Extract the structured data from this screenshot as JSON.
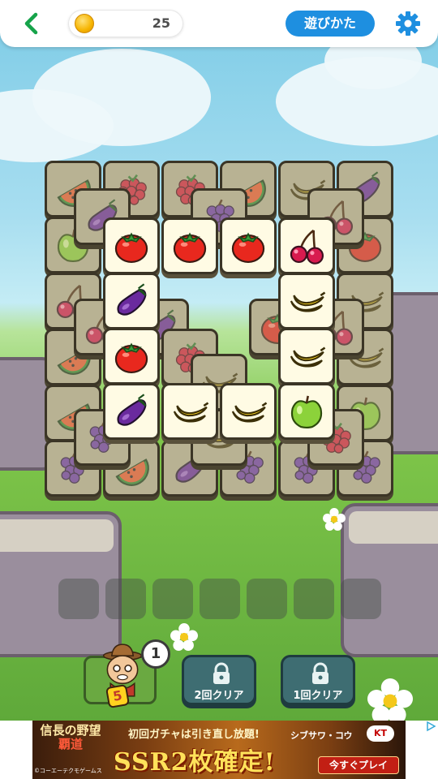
{
  "topbar": {
    "coin_count": "25",
    "howto_label": "遊びかた"
  },
  "board": {
    "tiles_bottom": [
      [
        "watermelon",
        "raspberry",
        "raspberry",
        "watermelon",
        "banana",
        "eggplant"
      ],
      [
        "apple",
        "",
        "",
        "",
        "",
        "tomato"
      ],
      [
        "cherry",
        "",
        "",
        "",
        "",
        "banana"
      ],
      [
        "watermelon",
        "",
        "",
        "",
        "",
        "banana"
      ],
      [
        "watermelon",
        "",
        "",
        "",
        "",
        "apple"
      ],
      [
        "grape",
        "watermelon",
        "eggplant",
        "grape",
        "grape",
        "grape"
      ]
    ],
    "tiles_middle": [
      "eggplant",
      "grape",
      "cherry",
      "cherry",
      "eggplant",
      "tomato",
      "cherry",
      "raspberry",
      "banana",
      "grape",
      "raspberry",
      "banana"
    ],
    "tiles_top": [
      [
        "tomato",
        "tomato",
        "tomato",
        "cherry"
      ],
      [
        "eggplant",
        "",
        "",
        "banana"
      ],
      [
        "tomato",
        "",
        "",
        "banana"
      ],
      [
        "eggplant",
        "banana",
        "banana",
        "apple"
      ]
    ]
  },
  "tray": {
    "slot_count": 7
  },
  "actions": {
    "character_count": "1",
    "character_badge": "5",
    "unlock_2": "2回クリア",
    "unlock_1": "1回クリア"
  },
  "ad": {
    "logo_line1": "信長の野望",
    "logo_line2": "覇道",
    "copyright": "©コーエーテクモゲームス",
    "headline": "初回ガチャは引き直し放題!",
    "big_text": "SSR2枚確定!",
    "brand": "シブサワ・コウ",
    "kt": "KT",
    "cta": "今すぐプレイ"
  },
  "colors": {
    "accent_blue": "#1e8fe0",
    "back_green": "#16a34a",
    "tile_face": "#fffbe4",
    "tile_border": "#3b3526"
  }
}
